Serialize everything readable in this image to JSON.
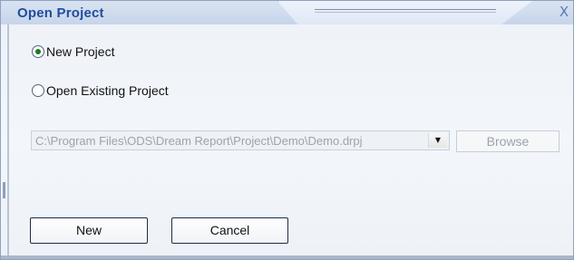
{
  "window": {
    "title": "Open Project",
    "close_glyph": "X"
  },
  "options": [
    {
      "label": "New Project",
      "selected": true
    },
    {
      "label": "Open Existing Project",
      "selected": false
    }
  ],
  "project_path": {
    "value": "C:\\Program Files\\ODS\\Dream Report\\Project\\Demo\\Demo.drpj",
    "arrow_glyph": "▼"
  },
  "buttons": {
    "browse": "Browse",
    "new": "New",
    "cancel": "Cancel"
  },
  "colors": {
    "title_text": "#1f4d9e",
    "radio_selected": "#1d7a1d",
    "disabled_text": "#9aa4b0"
  }
}
